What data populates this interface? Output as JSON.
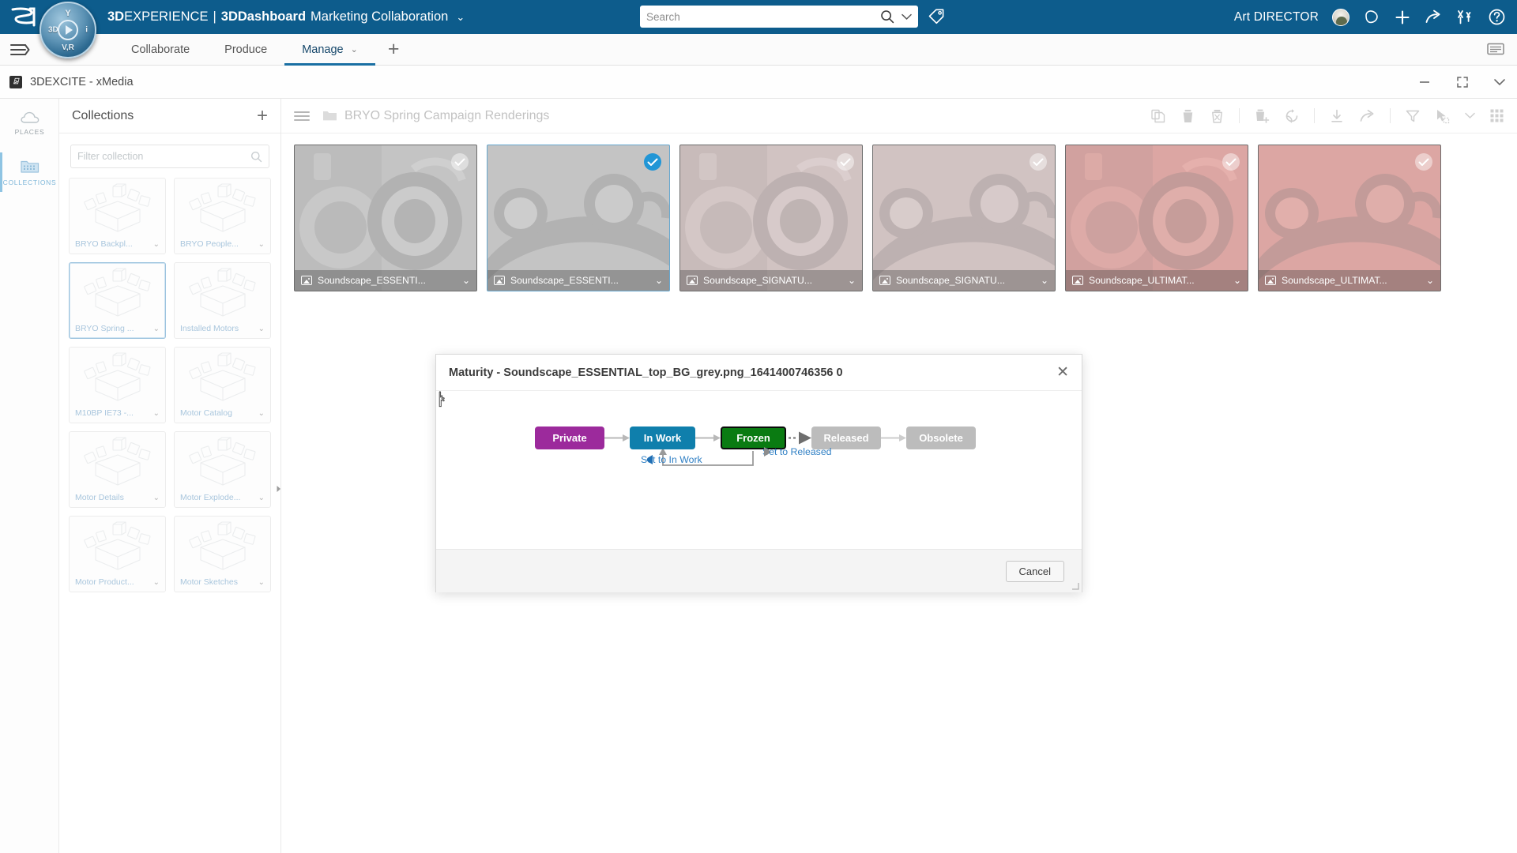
{
  "topbar": {
    "brand_bold": "3D",
    "brand_rest": "EXPERIENCE",
    "separator": "|",
    "dashboard_bold": "3D",
    "dashboard_rest": "Dashboard",
    "dashboard_name": "Marketing Collaboration",
    "dashboard_caret": "⌄",
    "search_placeholder": "Search",
    "search_value": "",
    "user_name": "Art DIRECTOR",
    "icons": [
      "search-icon",
      "chevron-down-icon",
      "tag-icon",
      "avatar",
      "notification-icon",
      "add-icon",
      "share-icon",
      "community-icon",
      "help-icon"
    ]
  },
  "tabbar": {
    "tabs": [
      {
        "label": "Collaborate",
        "active": false,
        "has_caret": false
      },
      {
        "label": "Produce",
        "active": false,
        "has_caret": false
      },
      {
        "label": "Manage",
        "active": true,
        "has_caret": true,
        "caret": "⌄"
      }
    ],
    "add_tab_label": "+"
  },
  "window": {
    "title": "3DEXCITE - xMedia",
    "icon_letter": "⍄",
    "controls": [
      "minimize",
      "maximize",
      "chevron-down"
    ]
  },
  "rail": {
    "items": [
      {
        "label": "PLACES",
        "icon": "cloud-icon",
        "active": false
      },
      {
        "label": "COLLECTIONS",
        "icon": "folder-icon",
        "active": true
      }
    ]
  },
  "collections": {
    "title": "Collections",
    "add_label": "+",
    "filter_placeholder": "Filter collection",
    "filter_value": "",
    "caret": "⌄",
    "cards": [
      {
        "name": "BRYO Backpl...",
        "selected": false
      },
      {
        "name": "BRYO People...",
        "selected": false
      },
      {
        "name": "BRYO Spring ...",
        "selected": true
      },
      {
        "name": "Installed Motors",
        "selected": false
      },
      {
        "name": "M10BP IE73 -...",
        "selected": false
      },
      {
        "name": "Motor Catalog",
        "selected": false
      },
      {
        "name": "Motor Details",
        "selected": false
      },
      {
        "name": "Motor Explode...",
        "selected": false
      },
      {
        "name": "Motor Product...",
        "selected": false
      },
      {
        "name": "Motor Sketches",
        "selected": false
      }
    ]
  },
  "content": {
    "breadcrumb_folder": "folder-icon",
    "breadcrumb_title": "BRYO Spring Campaign Renderings",
    "toolbar_icons": [
      "copy-icon",
      "delete-icon",
      "trash-icon",
      "paste-new-icon",
      "revise-icon",
      "download-icon",
      "share-icon",
      "filter-icon",
      "select-icon",
      "chevron-down-icon",
      "grid-view-icon"
    ],
    "thumbnails": [
      {
        "name": "Soundscape_ESSENTI...",
        "selected": false,
        "tint": "grey",
        "view": "side",
        "caret": "⌄"
      },
      {
        "name": "Soundscape_ESSENTI...",
        "selected": true,
        "tint": "grey",
        "view": "top",
        "caret": "⌄"
      },
      {
        "name": "Soundscape_SIGNATU...",
        "selected": false,
        "tint": "rose",
        "view": "side",
        "caret": "⌄"
      },
      {
        "name": "Soundscape_SIGNATU...",
        "selected": false,
        "tint": "rose",
        "view": "top",
        "caret": "⌄"
      },
      {
        "name": "Soundscape_ULTIMAT...",
        "selected": false,
        "tint": "red",
        "view": "side",
        "caret": "⌄"
      },
      {
        "name": "Soundscape_ULTIMAT...",
        "selected": false,
        "tint": "red",
        "view": "top",
        "caret": "⌄"
      }
    ]
  },
  "modal": {
    "title": "Maturity - Soundscape_ESSENTIAL_top_BG_grey.png_1641400746356 0",
    "close_label": "✕",
    "cancel_label": "Cancel",
    "workflow": {
      "states": [
        {
          "key": "private",
          "label": "Private",
          "color": "#9c2a9c",
          "current": false
        },
        {
          "key": "inwork",
          "label": "In Work",
          "color": "#0f7fac",
          "current": false
        },
        {
          "key": "frozen",
          "label": "Frozen",
          "color": "#0a7b12",
          "current": true
        },
        {
          "key": "released",
          "label": "Released",
          "color": "#bcbcbc",
          "current": false
        },
        {
          "key": "obsolete",
          "label": "Obsolete",
          "color": "#bcbcbc",
          "current": false
        }
      ],
      "actions": [
        {
          "label": "Set to In Work",
          "direction": "backward",
          "color": "#2f7fc4"
        },
        {
          "label": "Set to Released",
          "direction": "forward",
          "color": "#2f7fc4"
        }
      ]
    }
  },
  "colors": {
    "brand_blue": "#0d5c8c",
    "accent_blue": "#2196d6",
    "tab_active": "#1a6fa3",
    "link_blue": "#2f7fc4",
    "state_private": "#9c2a9c",
    "state_inwork": "#0f7fac",
    "state_frozen": "#0a7b12",
    "state_inactive": "#bcbcbc"
  }
}
